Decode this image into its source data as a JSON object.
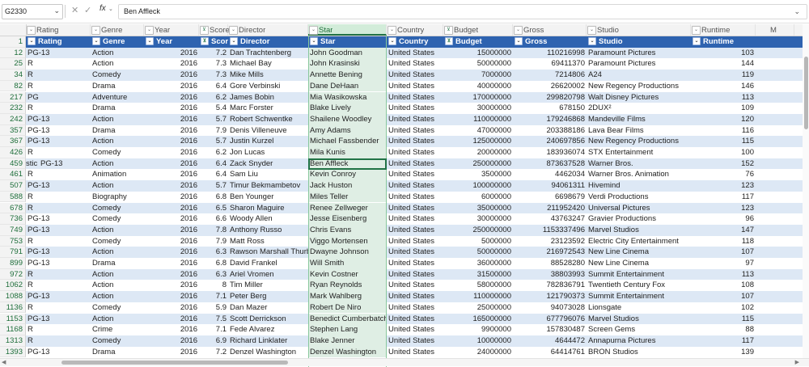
{
  "formula_bar": {
    "name_box": "G2330",
    "formula": "Ben Affleck",
    "fx_label": "fx"
  },
  "columns": [
    {
      "letter": "Rating",
      "filtered": false
    },
    {
      "letter": "Genre",
      "filtered": false
    },
    {
      "letter": "Year",
      "filtered": false
    },
    {
      "letter": "Score",
      "filtered": true
    },
    {
      "letter": "Director",
      "filtered": false
    },
    {
      "letter": "Star",
      "filtered": false
    },
    {
      "letter": "Country",
      "filtered": false
    },
    {
      "letter": "Budget",
      "filtered": true
    },
    {
      "letter": "Gross",
      "filtered": false
    },
    {
      "letter": "Studio",
      "filtered": false
    },
    {
      "letter": "Runtime",
      "filtered": false
    },
    {
      "letter": "M",
      "filtered": false
    }
  ],
  "header_row": {
    "row_number": "1",
    "labels": [
      "Rating",
      "Genre",
      "Year",
      "Score",
      "Director",
      "Star",
      "Country",
      "Budget",
      "Gross",
      "Studio",
      "Runtime"
    ]
  },
  "rows": [
    {
      "n": "12",
      "pre": "",
      "rating": "PG-13",
      "genre": "Action",
      "year": "2016",
      "score": "7.2",
      "director": "Dan Trachtenberg",
      "star": "John Goodman",
      "country": "United States",
      "budget": "15000000",
      "gross": "110216998",
      "studio": "Paramount Pictures",
      "runtime": "103"
    },
    {
      "n": "25",
      "pre": "",
      "rating": "R",
      "genre": "Action",
      "year": "2016",
      "score": "7.3",
      "director": "Michael Bay",
      "star": "John Krasinski",
      "country": "United States",
      "budget": "50000000",
      "gross": "69411370",
      "studio": "Paramount Pictures",
      "runtime": "144"
    },
    {
      "n": "34",
      "pre": "",
      "rating": "R",
      "genre": "Comedy",
      "year": "2016",
      "score": "7.3",
      "director": "Mike Mills",
      "star": "Annette Bening",
      "country": "United States",
      "budget": "7000000",
      "gross": "7214806",
      "studio": "A24",
      "runtime": "119"
    },
    {
      "n": "82",
      "pre": "",
      "rating": "R",
      "genre": "Drama",
      "year": "2016",
      "score": "6.4",
      "director": "Gore Verbinski",
      "star": "Dane DeHaan",
      "country": "United States",
      "budget": "40000000",
      "gross": "26620002",
      "studio": "New Regency Productions",
      "runtime": "146"
    },
    {
      "n": "217",
      "pre": "",
      "rating": "PG",
      "genre": "Adventure",
      "year": "2016",
      "score": "6.2",
      "director": "James Bobin",
      "star": "Mia Wasikowska",
      "country": "United States",
      "budget": "170000000",
      "gross": "299820798",
      "studio": "Walt Disney Pictures",
      "runtime": "113"
    },
    {
      "n": "232",
      "pre": "",
      "rating": "R",
      "genre": "Drama",
      "year": "2016",
      "score": "5.4",
      "director": "Marc Forster",
      "star": "Blake Lively",
      "country": "United States",
      "budget": "30000000",
      "gross": "678150",
      "studio": "2DUX²",
      "runtime": "109"
    },
    {
      "n": "242",
      "pre": "",
      "rating": "PG-13",
      "genre": "Action",
      "year": "2016",
      "score": "5.7",
      "director": "Robert Schwentke",
      "star": "Shailene Woodley",
      "country": "United States",
      "budget": "110000000",
      "gross": "179246868",
      "studio": "Mandeville Films",
      "runtime": "120"
    },
    {
      "n": "357",
      "pre": "",
      "rating": "PG-13",
      "genre": "Drama",
      "year": "2016",
      "score": "7.9",
      "director": "Denis Villeneuve",
      "star": "Amy Adams",
      "country": "United States",
      "budget": "47000000",
      "gross": "203388186",
      "studio": "Lava Bear Films",
      "runtime": "116"
    },
    {
      "n": "367",
      "pre": "",
      "rating": "PG-13",
      "genre": "Action",
      "year": "2016",
      "score": "5.7",
      "director": "Justin Kurzel",
      "star": "Michael Fassbender",
      "country": "United States",
      "budget": "125000000",
      "gross": "240697856",
      "studio": "New Regency Productions",
      "runtime": "115"
    },
    {
      "n": "426",
      "pre": "",
      "rating": "R",
      "genre": "Comedy",
      "year": "2016",
      "score": "6.2",
      "director": "Jon Lucas",
      "star": "Mila Kunis",
      "country": "United States",
      "budget": "20000000",
      "gross": "183936074",
      "studio": "STX Entertainment",
      "runtime": "100"
    },
    {
      "n": "459",
      "pre": "stic",
      "rating": "PG-13",
      "genre": "Action",
      "year": "2016",
      "score": "6.4",
      "director": "Zack Snyder",
      "star": "Ben Affleck",
      "country": "United States",
      "budget": "250000000",
      "gross": "873637528",
      "studio": "Warner Bros.",
      "runtime": "152"
    },
    {
      "n": "461",
      "pre": "",
      "rating": "R",
      "genre": "Animation",
      "year": "2016",
      "score": "6.4",
      "director": "Sam Liu",
      "star": "Kevin Conroy",
      "country": "United States",
      "budget": "3500000",
      "gross": "4462034",
      "studio": "Warner Bros. Animation",
      "runtime": "76"
    },
    {
      "n": "507",
      "pre": "",
      "rating": "PG-13",
      "genre": "Action",
      "year": "2016",
      "score": "5.7",
      "director": "Timur Bekmambetov",
      "star": "Jack Huston",
      "country": "United States",
      "budget": "100000000",
      "gross": "94061311",
      "studio": "Hivemind",
      "runtime": "123"
    },
    {
      "n": "588",
      "pre": "",
      "rating": "R",
      "genre": "Biography",
      "year": "2016",
      "score": "6.8",
      "director": "Ben Younger",
      "star": "Miles Teller",
      "country": "United States",
      "budget": "6000000",
      "gross": "6698679",
      "studio": "Verdi Productions",
      "runtime": "117"
    },
    {
      "n": "678",
      "pre": "",
      "rating": "R",
      "genre": "Comedy",
      "year": "2016",
      "score": "6.5",
      "director": "Sharon Maguire",
      "star": "Renee Zellweger",
      "country": "United States",
      "budget": "35000000",
      "gross": "211952420",
      "studio": "Universal Pictures",
      "runtime": "123"
    },
    {
      "n": "736",
      "pre": "",
      "rating": "PG-13",
      "genre": "Comedy",
      "year": "2016",
      "score": "6.6",
      "director": "Woody Allen",
      "star": "Jesse Eisenberg",
      "country": "United States",
      "budget": "30000000",
      "gross": "43763247",
      "studio": "Gravier Productions",
      "runtime": "96"
    },
    {
      "n": "749",
      "pre": "",
      "rating": "PG-13",
      "genre": "Action",
      "year": "2016",
      "score": "7.8",
      "director": "Anthony Russo",
      "star": "Chris Evans",
      "country": "United States",
      "budget": "250000000",
      "gross": "1153337496",
      "studio": "Marvel Studios",
      "runtime": "147"
    },
    {
      "n": "753",
      "pre": "",
      "rating": "R",
      "genre": "Comedy",
      "year": "2016",
      "score": "7.9",
      "director": "Matt Ross",
      "star": "Viggo Mortensen",
      "country": "United States",
      "budget": "5000000",
      "gross": "23123592",
      "studio": "Electric City Entertainment",
      "runtime": "118"
    },
    {
      "n": "791",
      "pre": "",
      "rating": "PG-13",
      "genre": "Action",
      "year": "2016",
      "score": "6.3",
      "director": "Rawson Marshall Thurber",
      "star": "Dwayne Johnson",
      "country": "United States",
      "budget": "50000000",
      "gross": "216972543",
      "studio": "New Line Cinema",
      "runtime": "107"
    },
    {
      "n": "899",
      "pre": "",
      "rating": "PG-13",
      "genre": "Drama",
      "year": "2016",
      "score": "6.8",
      "director": "David Frankel",
      "star": "Will Smith",
      "country": "United States",
      "budget": "36000000",
      "gross": "88528280",
      "studio": "New Line Cinema",
      "runtime": "97"
    },
    {
      "n": "972",
      "pre": "",
      "rating": "R",
      "genre": "Action",
      "year": "2016",
      "score": "6.3",
      "director": "Ariel Vromen",
      "star": "Kevin Costner",
      "country": "United States",
      "budget": "31500000",
      "gross": "38803993",
      "studio": "Summit Entertainment",
      "runtime": "113"
    },
    {
      "n": "1062",
      "pre": "",
      "rating": "R",
      "genre": "Action",
      "year": "2016",
      "score": "8",
      "director": "Tim Miller",
      "star": "Ryan Reynolds",
      "country": "United States",
      "budget": "58000000",
      "gross": "782836791",
      "studio": "Twentieth Century Fox",
      "runtime": "108"
    },
    {
      "n": "1088",
      "pre": "",
      "rating": "PG-13",
      "genre": "Action",
      "year": "2016",
      "score": "7.1",
      "director": "Peter Berg",
      "star": "Mark Wahlberg",
      "country": "United States",
      "budget": "110000000",
      "gross": "121790373",
      "studio": "Summit Entertainment",
      "runtime": "107"
    },
    {
      "n": "1136",
      "pre": "",
      "rating": "R",
      "genre": "Comedy",
      "year": "2016",
      "score": "5.9",
      "director": "Dan Mazer",
      "star": "Robert De Niro",
      "country": "United States",
      "budget": "25000000",
      "gross": "94073028",
      "studio": "Lionsgate",
      "runtime": "102"
    },
    {
      "n": "1153",
      "pre": "",
      "rating": "PG-13",
      "genre": "Action",
      "year": "2016",
      "score": "7.5",
      "director": "Scott Derrickson",
      "star": "Benedict Cumberbatch",
      "country": "United States",
      "budget": "165000000",
      "gross": "677796076",
      "studio": "Marvel Studios",
      "runtime": "115"
    },
    {
      "n": "1168",
      "pre": "",
      "rating": "R",
      "genre": "Crime",
      "year": "2016",
      "score": "7.1",
      "director": "Fede Alvarez",
      "star": "Stephen Lang",
      "country": "United States",
      "budget": "9900000",
      "gross": "157830487",
      "studio": "Screen Gems",
      "runtime": "88"
    },
    {
      "n": "1313",
      "pre": "",
      "rating": "R",
      "genre": "Comedy",
      "year": "2016",
      "score": "6.9",
      "director": "Richard Linklater",
      "star": "Blake Jenner",
      "country": "United States",
      "budget": "10000000",
      "gross": "4644472",
      "studio": "Annapurna Pictures",
      "runtime": "117"
    },
    {
      "n": "1393",
      "pre": "",
      "rating": "PG-13",
      "genre": "Drama",
      "year": "2016",
      "score": "7.2",
      "director": "Denzel Washington",
      "star": "Denzel Washington",
      "country": "United States",
      "budget": "24000000",
      "gross": "64414761",
      "studio": "BRON Studios",
      "runtime": "139"
    }
  ]
}
